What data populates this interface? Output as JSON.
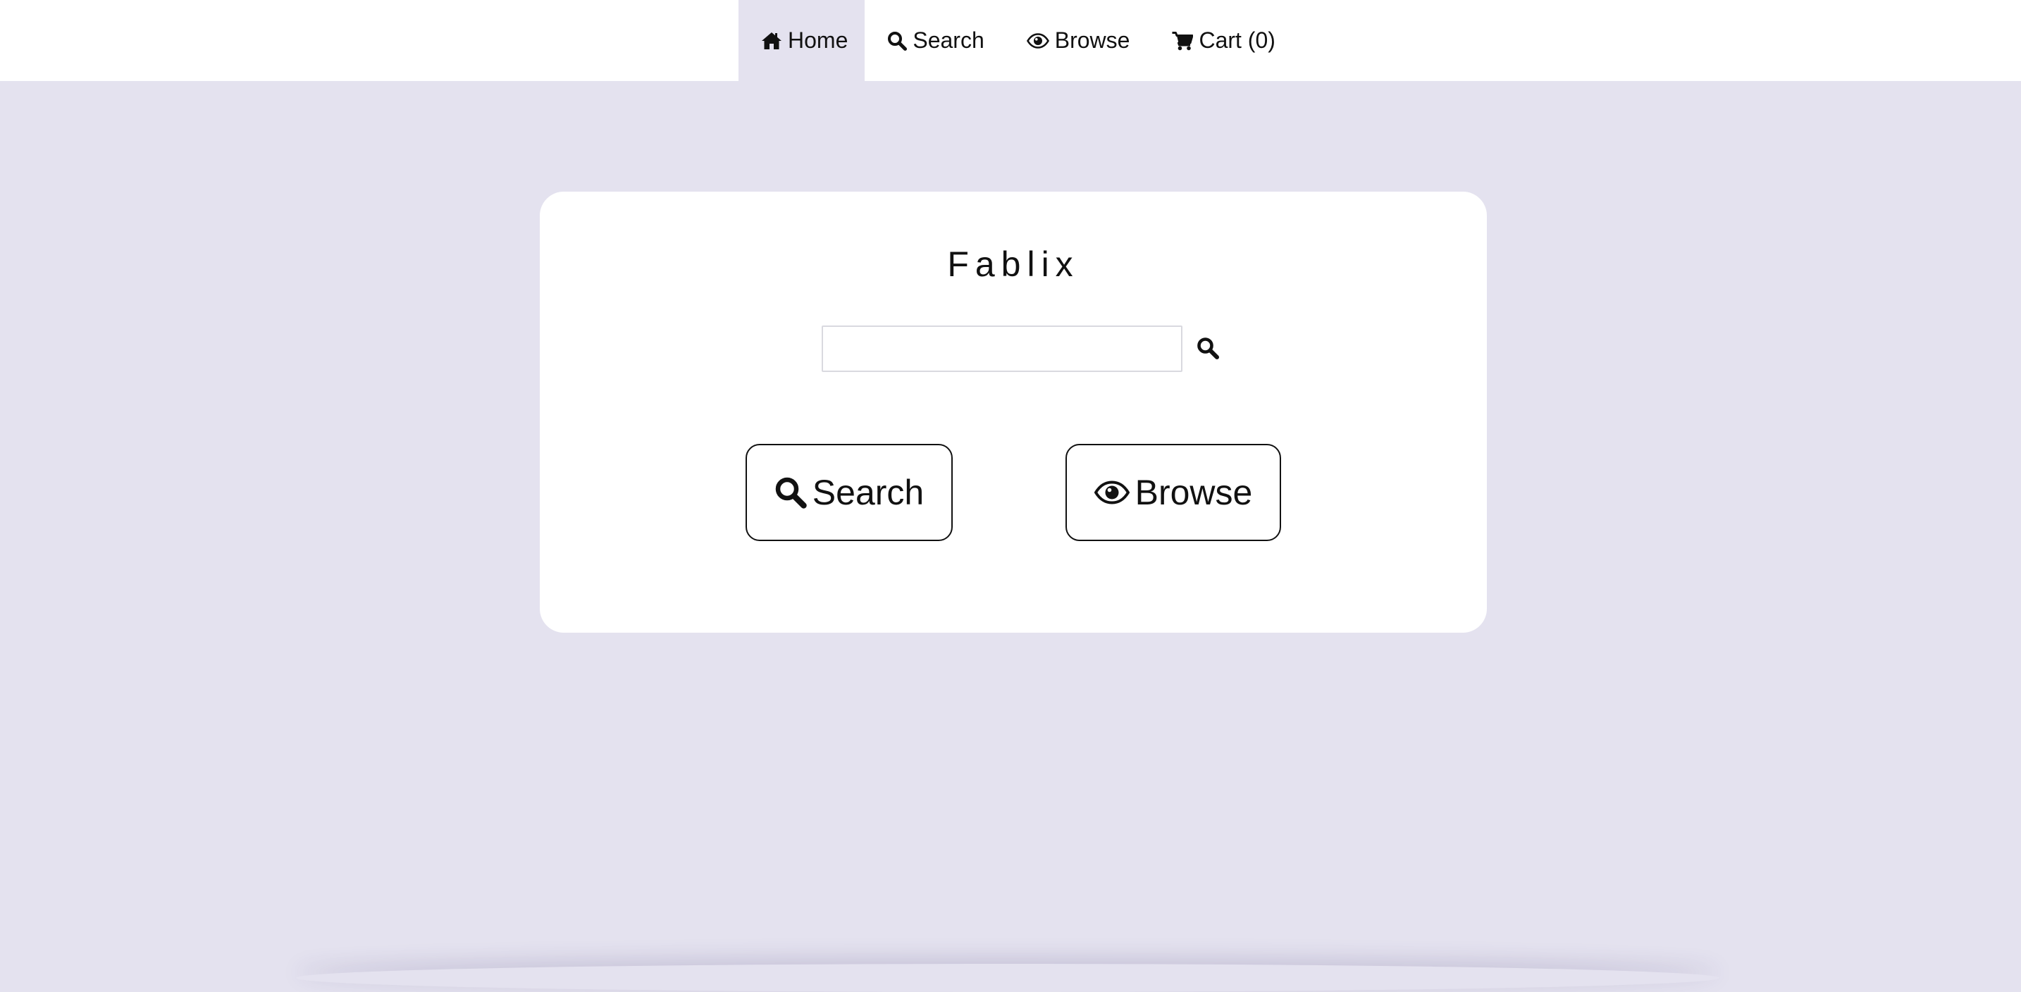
{
  "nav": {
    "items": [
      {
        "label": "Home",
        "icon": "home-icon",
        "active": true
      },
      {
        "label": "Search",
        "icon": "search-icon",
        "active": false
      },
      {
        "label": "Browse",
        "icon": "eye-icon",
        "active": false
      },
      {
        "label": "Cart (0)",
        "icon": "cart-icon",
        "active": false
      }
    ]
  },
  "main": {
    "brand": "Fablix",
    "search": {
      "value": "",
      "placeholder": "",
      "submit_icon": "search-icon"
    },
    "buttons": {
      "search_label": "Search",
      "browse_label": "Browse"
    }
  },
  "colors": {
    "background": "#e4e2ef",
    "surface": "#ffffff",
    "text": "#111111",
    "nav_active": "#e4e2ef"
  }
}
